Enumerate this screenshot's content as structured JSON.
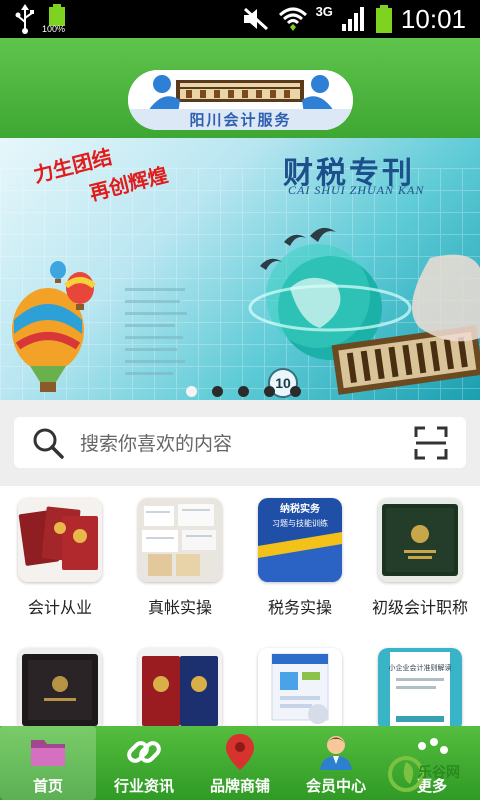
{
  "status_bar": {
    "battery_small_label": "100%",
    "network": "3G",
    "clock": "10:01",
    "icons": [
      "usb-icon",
      "battery-icon",
      "mute-icon",
      "wifi-icon",
      "signal-icon",
      "battery-icon"
    ]
  },
  "header": {
    "logo_text": "阳川会计服务"
  },
  "banner": {
    "slogan_line1": "力生团结",
    "slogan_line2": "再创辉煌",
    "magazine_title": "财税专刊",
    "magazine_pinyin": "CAI SHUI ZHUAN KAN",
    "issue_number": "10",
    "slide_count": 5,
    "active_slide": 1
  },
  "search": {
    "placeholder": "搜索你喜欢的内容"
  },
  "categories": [
    {
      "label": "会计从业",
      "thumb": "certificates-red"
    },
    {
      "label": "真帐实操",
      "thumb": "receipts"
    },
    {
      "label": "税务实操",
      "thumb": "book-blue",
      "thumb_text": "纳税实务\n习题与技能训练"
    },
    {
      "label": "初级会计职称",
      "thumb": "certificate-green"
    },
    {
      "label": "",
      "thumb": "certificate-dark"
    },
    {
      "label": "",
      "thumb": "certificates-red-blue"
    },
    {
      "label": "",
      "thumb": "software-box"
    },
    {
      "label": "",
      "thumb": "book-teal",
      "thumb_text": "小企业会计准则解读"
    }
  ],
  "tabbar": {
    "tabs": [
      {
        "label": "首页",
        "icon": "folder-icon"
      },
      {
        "label": "行业资讯",
        "icon": "link-icon"
      },
      {
        "label": "品牌商铺",
        "icon": "map-pin-icon"
      },
      {
        "label": "会员中心",
        "icon": "user-icon"
      },
      {
        "label": "更多",
        "icon": "more-icon"
      }
    ],
    "active_index": 0
  },
  "watermark": {
    "text": "乐谷网"
  },
  "colors": {
    "brand_green": "#3ea733",
    "banner_title": "#1d4f8a",
    "slogan_red": "#e21b1b"
  }
}
